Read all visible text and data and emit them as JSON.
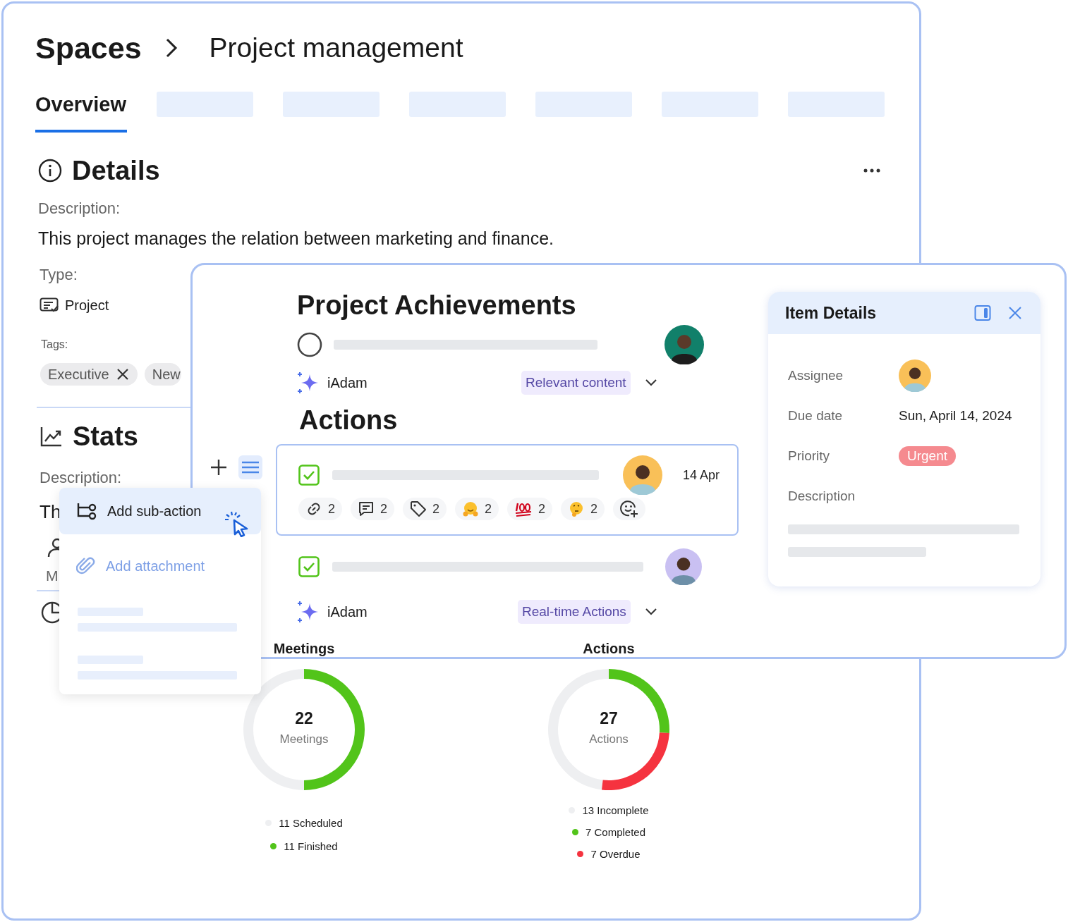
{
  "breadcrumb": {
    "root": "Spaces",
    "current": "Project management"
  },
  "tabs": [
    {
      "label": "Overview",
      "selected": true
    }
  ],
  "details": {
    "title": "Details",
    "description_label": "Description:",
    "description": "This project manages the relation between marketing and finance.",
    "type_label": "Type:",
    "type": "Project",
    "tags_label": "Tags:",
    "tags": [
      {
        "label": "Executive",
        "removable": true
      },
      {
        "label": "New",
        "removable": false
      }
    ]
  },
  "stats": {
    "title": "Stats",
    "description_label": "Description:",
    "description": "Th",
    "field": "M"
  },
  "charts": [
    {
      "chart_data": {
        "type": "donut",
        "title": "Meetings",
        "categories": [
          "Scheduled",
          "Finished"
        ],
        "values": [
          11,
          11
        ],
        "value_labels": [
          "11",
          "11"
        ],
        "legend": "bottom"
      },
      "total": "22",
      "center_label": "Meetings",
      "legend": [
        {
          "color": "#eeeff1"
        },
        {
          "color": "#52c41a"
        }
      ]
    },
    {
      "chart_data": {
        "type": "donut",
        "title": "Actions",
        "categories": [
          "Incomplete",
          "Completed",
          "Overdue"
        ],
        "values": [
          13,
          7,
          7
        ],
        "value_labels": [
          "13",
          "7",
          "7"
        ],
        "legend": "bottom"
      },
      "total": "27",
      "center_label": "Actions",
      "legend": [
        {
          "color": "#eeeff1"
        },
        {
          "color": "#52c41a"
        },
        {
          "color": "#f5333f"
        }
      ]
    }
  ],
  "achievements": {
    "title": "Project Achievements",
    "items": [
      {
        "checked": false,
        "assistant": "iAdam",
        "tag": "Relevant content"
      }
    ]
  },
  "actions": {
    "title": "Actions",
    "items": [
      {
        "checked": true,
        "selected": true,
        "due": "14 Apr",
        "reactions": [
          {
            "kind": "link",
            "count": "2"
          },
          {
            "kind": "comment",
            "count": "2"
          },
          {
            "kind": "tag",
            "count": "2"
          },
          {
            "kind": "hug",
            "count": "2"
          },
          {
            "kind": "hundred",
            "count": "2"
          },
          {
            "kind": "thinking",
            "count": "2"
          },
          {
            "kind": "add"
          }
        ]
      },
      {
        "checked": true,
        "selected": false,
        "assistant": "iAdam",
        "tag": "Real-time Actions"
      }
    ]
  },
  "menu": [
    {
      "kind": "sub-action",
      "label": "Add sub-action",
      "selected": true
    },
    {
      "kind": "attachment",
      "label": "Add attachment",
      "selected": false
    }
  ],
  "item_details": {
    "title": "Item Details",
    "fields": [
      {
        "kind": "avatar",
        "label": "Assignee"
      },
      {
        "kind": "text",
        "label": "Due date",
        "value": "Sun, April 14, 2024"
      },
      {
        "kind": "chip",
        "label": "Priority",
        "value": "Urgent"
      },
      {
        "kind": "skeleton",
        "label": "Description"
      }
    ]
  }
}
